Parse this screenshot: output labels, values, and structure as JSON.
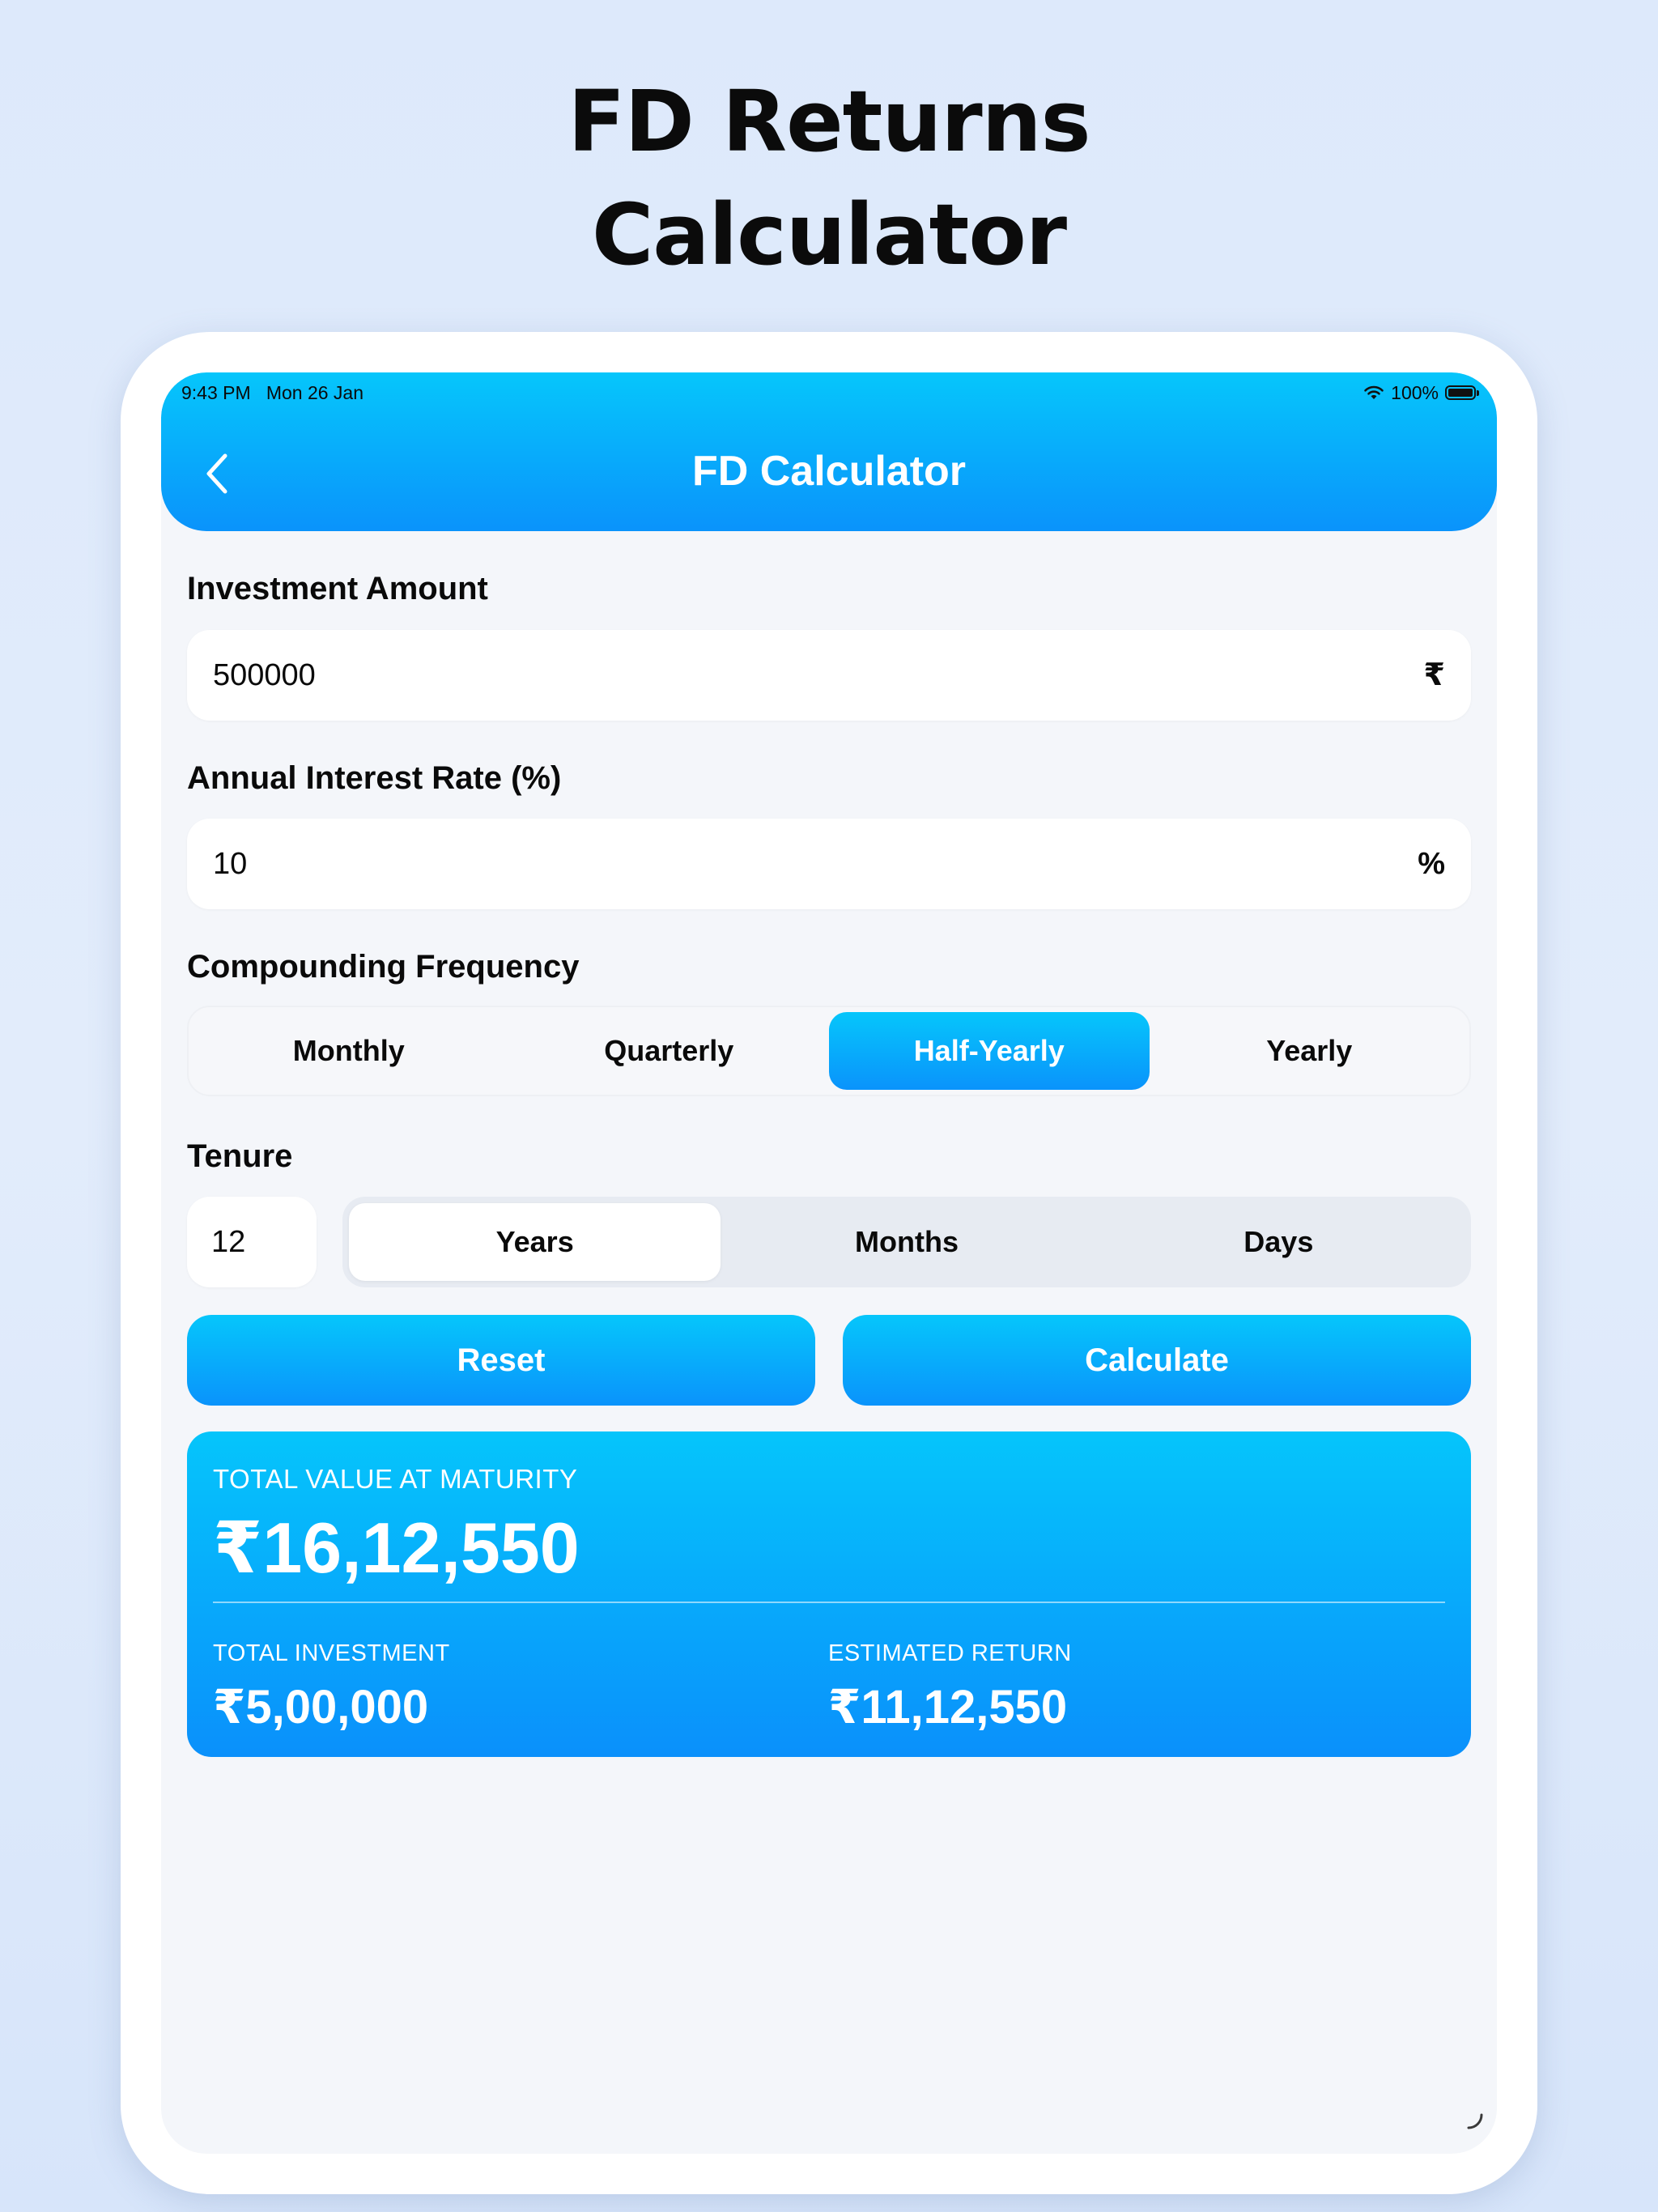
{
  "headline": {
    "line1": "FD Returns",
    "line2": "Calculator"
  },
  "status_bar": {
    "time": "9:43 PM   Mon 26 Jan",
    "battery": "100%"
  },
  "nav": {
    "title": "FD Calculator"
  },
  "investment": {
    "label": "Investment Amount",
    "value": "500000",
    "suffix": "₹"
  },
  "interest": {
    "label": "Annual Interest Rate (%)",
    "value": "10",
    "suffix": "%"
  },
  "compounding": {
    "label": "Compounding Frequency",
    "options": [
      "Monthly",
      "Quarterly",
      "Half-Yearly",
      "Yearly"
    ],
    "selected": "Half-Yearly"
  },
  "tenure": {
    "label": "Tenure",
    "value": "12",
    "units": [
      "Years",
      "Months",
      "Days"
    ],
    "selected": "Years"
  },
  "actions": {
    "reset": "Reset",
    "calculate": "Calculate"
  },
  "result": {
    "maturity_label": "TOTAL VALUE AT MATURITY",
    "maturity_value": "₹16,12,550",
    "investment_label": "TOTAL INVESTMENT",
    "investment_value": "₹5,00,000",
    "return_label": "ESTIMATED RETURN",
    "return_value": "₹11,12,550"
  },
  "colors": {
    "accent_top": "#06c6fb",
    "accent_bottom": "#0a93fb",
    "screen_bg": "#f4f6fa"
  }
}
